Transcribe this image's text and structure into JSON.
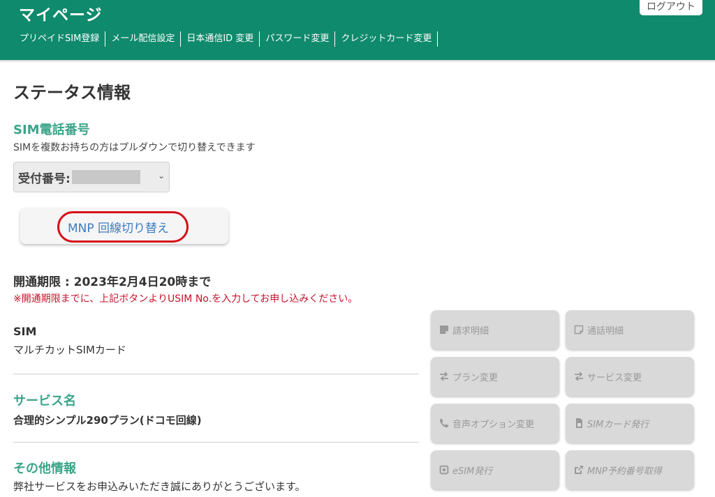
{
  "header": {
    "title": "マイページ",
    "logout_label": "ログアウト",
    "nav": [
      {
        "label": "プリペイドSIM登録"
      },
      {
        "label": "メール配信設定"
      },
      {
        "label": "日本通信ID 変更"
      },
      {
        "label": "パスワード変更"
      },
      {
        "label": "クレジットカード変更"
      }
    ],
    "color": "#0f8a6c"
  },
  "main": {
    "page_title": "ステータス情報",
    "sim_section": {
      "heading": "SIM電話番号",
      "description": "SIMを複数お持ちの方はプルダウンで切り替えできます",
      "select_label": "受付番号:"
    },
    "mnp_button_label": "MNP 回線切り替え",
    "deadline": "開通期限 : 2023年2月4日20時まで",
    "notice": "※開通期限までに、上記ボタンよりUSIM No.を入力してお申し込みください。",
    "sim_label": "SIM",
    "sim_value": "マルチカットSIMカード",
    "service_heading": "サービス名",
    "service_value": "合理的シンプル290プラン(ドコモ回線)",
    "other_heading": "その他情報",
    "other_value": "弊社サービスをお申込みいただき誠にありがとうございます。"
  },
  "actions": [
    {
      "label": "請求明細",
      "icon": "note-icon"
    },
    {
      "label": "通話明細",
      "icon": "note-icon"
    },
    {
      "label": "プラン変更",
      "icon": "swap-icon"
    },
    {
      "label": "サービス変更",
      "icon": "swap-icon"
    },
    {
      "label": "音声オプション変更",
      "icon": "phone-icon"
    },
    {
      "label": "SIMカード発行",
      "icon": "sim-card-icon"
    },
    {
      "label": "eSIM発行",
      "icon": "chip-icon"
    },
    {
      "label": "MNP予約番号取得",
      "icon": "share-icon"
    }
  ],
  "colors": {
    "accent": "#3aa58a",
    "link": "#3b7dc4",
    "warning": "#c4142b",
    "highlight_oval": "#d60f1a"
  }
}
